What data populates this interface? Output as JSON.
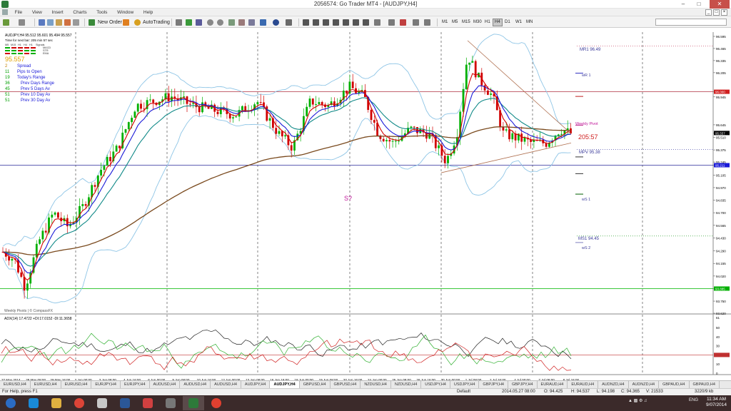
{
  "window": {
    "title": "2056574: Go Trader MT4 - [AUDJPY,H4]"
  },
  "menu": [
    "File",
    "View",
    "Insert",
    "Charts",
    "Tools",
    "Window",
    "Help"
  ],
  "toolbar": {
    "new_order": "New Order",
    "autotrading": "AutoTrading",
    "timeframes": [
      "M1",
      "M5",
      "M15",
      "M30",
      "H1",
      "H4",
      "D1",
      "W1",
      "MN"
    ],
    "active_timeframe": "H4"
  },
  "chart_info": {
    "header": "AUDJPY,H4  95.512 95.601 95.494 95.557",
    "countdown": "Time for next bar: 205 min 57 sec",
    "mini_tf": [
      "M5",
      "M15",
      "H1",
      "H4",
      "H1",
      "Signals"
    ],
    "mini_ind": [
      "MACD",
      "STR",
      "EMA"
    ],
    "price": "95.557",
    "stats": [
      {
        "value": "2",
        "label": "Spread"
      },
      {
        "value": "11",
        "label": "Pips to Open"
      },
      {
        "value": "19",
        "label": "Today's Range"
      },
      {
        "value": "36",
        "label": "Prev Days Range"
      },
      {
        "value": "45",
        "label": "Prev 5 Days Av"
      },
      {
        "value": "51",
        "label": "Prev 10 Day Av"
      },
      {
        "value": "51",
        "label": "Prev 30 Day Av"
      }
    ],
    "watermark": "Weekly Pivots | © CompassFX",
    "annotation": "S?",
    "countdown_label": "205:57"
  },
  "pivots": {
    "mr1": "MR1  96.49",
    "wr1": "wR 1",
    "weekly_pivot": "Weekly Pivot",
    "mpv": "MPV  95.38",
    "ws1": "wS 1",
    "ms1": "MS1  94.45",
    "ws2": "wS 2"
  },
  "price_axis": [
    "96.595",
    "96.465",
    "96.335",
    "96.205",
    "96.000",
    "95.945",
    "95.645",
    "95.557",
    "95.510",
    "95.375",
    "95.245",
    "95.211",
    "95.105",
    "94.970",
    "94.835",
    "94.700",
    "94.565",
    "94.430",
    "94.290",
    "94.155",
    "94.020",
    "93.885",
    "93.750",
    "93.620"
  ],
  "price_axis_badges": {
    "red": "96.000",
    "current": "95.557",
    "blue": "95.211",
    "green": "93.885"
  },
  "indicator": {
    "label": "ADX(14) 17.4722 +DI:17.0152 -DI:11.3658",
    "axis": [
      "61",
      "50",
      "40",
      "30",
      "20.000",
      "10",
      "0"
    ]
  },
  "time_axis": [
    "27 May 2014",
    "28 May 08:00",
    "29 May 16:00",
    "2 Jun 00:00",
    "3 Jun 08:00",
    "4 Jun 16:00",
    "6 Jun 00:00",
    "9 Jun 08:00",
    "10 Jun 16:00",
    "12 Jun 00:00",
    "13 Jun 08:00",
    "16 Jun 16:00",
    "18 Jun 00:00",
    "19 Jun 08:00",
    "20 Jun 16:00",
    "24 Jun 00:00",
    "25 Jun 08:00",
    "26 Jun 16:00",
    "30 Jun 00:00",
    "1 Jul 08:00",
    "2 Jul 16:00",
    "4 Jul 00:00",
    "7 Jul 08:00",
    "8 Jul 16:00"
  ],
  "tabs": [
    "EURUSD,H4",
    "EURUSD,H4",
    "EURUSD,H4",
    "EURJPY,H4",
    "EURJPY,H4",
    "AUDUSD,H4",
    "AUDUSD,H4",
    "AUDUSD,H4",
    "AUDJPY,H4",
    "AUDJPY,H4",
    "GBPUSD,H4",
    "GBPUSD,H4",
    "NZDUSD,H4",
    "NZDUSD,H4",
    "USDJPY,H4",
    "USDJPY,H4",
    "GBPJPY,H4",
    "GBPJPY,H4",
    "EURAUD,H4",
    "EURAUD,H4",
    "AUDNZD,H4",
    "AUDNZD,H4",
    "GBPAUD,H4",
    "GBPAUD,H4"
  ],
  "active_tab_index": 9,
  "status": {
    "help": "For Help, press F1",
    "profile": "Default",
    "time": "2014.05.27 08:00",
    "open": "O: 94.425",
    "high": "H: 94.537",
    "low": "L: 94.198",
    "close": "C: 94.365",
    "volume": "V: 21533",
    "traffic": "3220/9 kb"
  },
  "taskbar": {
    "lang": "ENG",
    "time": "11:34 AM",
    "date": "9/07/2014"
  },
  "colors": {
    "bull": "#00b000",
    "bear": "#d00000",
    "ema_fast": "#d40000",
    "ema_mid": "#1a1ad8",
    "ema_slow": "#118a88",
    "ma_long": "#7a4a1e",
    "bollinger": "#8ec5e6",
    "pivot_text": "#3b3b9a",
    "annotation": "#c0189a"
  }
}
